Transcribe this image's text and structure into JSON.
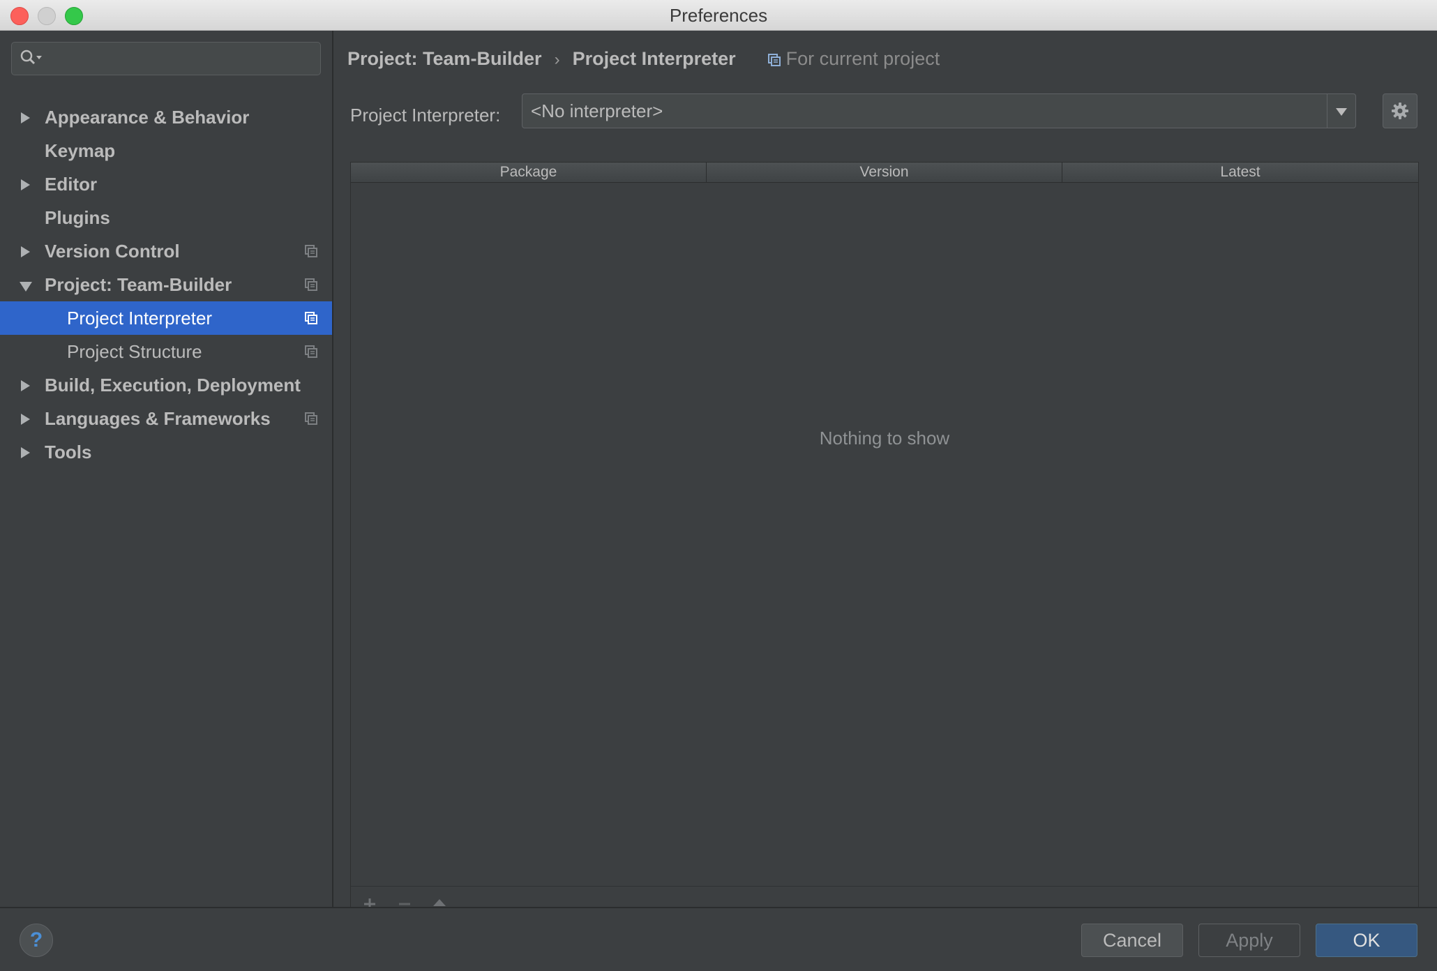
{
  "window": {
    "title": "Preferences"
  },
  "search": {
    "placeholder": ""
  },
  "sidebar": {
    "items": [
      {
        "label": "Appearance & Behavior",
        "expandable": "collapsed"
      },
      {
        "label": "Keymap",
        "expandable": "none"
      },
      {
        "label": "Editor",
        "expandable": "collapsed"
      },
      {
        "label": "Plugins",
        "expandable": "none"
      },
      {
        "label": "Version Control",
        "expandable": "collapsed",
        "project_scoped": true
      },
      {
        "label": "Project: Team-Builder",
        "expandable": "expanded",
        "project_scoped": true
      },
      {
        "label": "Project Interpreter",
        "child": true,
        "selected": true,
        "project_scoped": true
      },
      {
        "label": "Project Structure",
        "child": true,
        "project_scoped": true
      },
      {
        "label": "Build, Execution, Deployment",
        "expandable": "collapsed"
      },
      {
        "label": "Languages & Frameworks",
        "expandable": "collapsed",
        "project_scoped": true
      },
      {
        "label": "Tools",
        "expandable": "collapsed"
      }
    ]
  },
  "breadcrumb": {
    "parent": "Project: Team-Builder",
    "separator": "›",
    "current": "Project Interpreter",
    "scope": "For current project"
  },
  "interpreter": {
    "label": "Project Interpreter:",
    "value": "<No interpreter>"
  },
  "packages_table": {
    "columns": [
      "Package",
      "Version",
      "Latest"
    ],
    "rows": [],
    "empty_text": "Nothing to show"
  },
  "footer": {
    "help": "?",
    "cancel": "Cancel",
    "apply": "Apply",
    "ok": "OK"
  },
  "colors": {
    "selection": "#2f65ca",
    "background": "#3c3f41",
    "ok_button": "#365880"
  }
}
